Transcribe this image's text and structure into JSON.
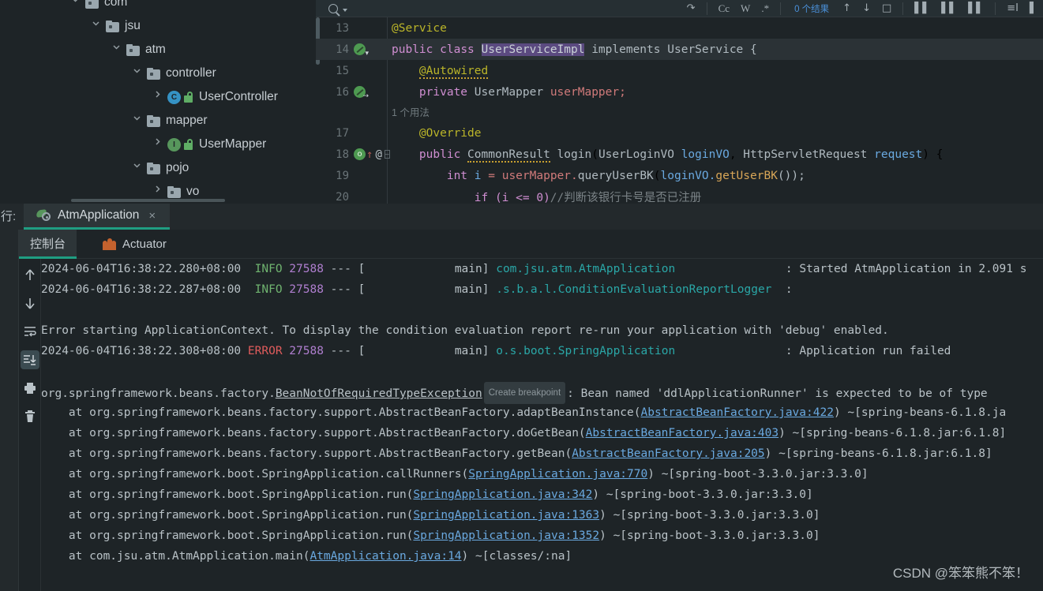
{
  "project_tree": {
    "items": [
      {
        "label": "com",
        "indent": 0,
        "icon": "folder-icon",
        "chevron": "down",
        "partial": true
      },
      {
        "label": "jsu",
        "indent": 1,
        "icon": "folder-icon",
        "chevron": "down"
      },
      {
        "label": "atm",
        "indent": 2,
        "icon": "folder-icon",
        "chevron": "down"
      },
      {
        "label": "controller",
        "indent": 3,
        "icon": "folder-icon",
        "chevron": "down"
      },
      {
        "label": "UserController",
        "indent": 4,
        "icon": "java-class-icon",
        "chevron": "right"
      },
      {
        "label": "mapper",
        "indent": 3,
        "icon": "folder-icon",
        "chevron": "down"
      },
      {
        "label": "UserMapper",
        "indent": 4,
        "icon": "java-interface-icon",
        "chevron": "right"
      },
      {
        "label": "pojo",
        "indent": 3,
        "icon": "folder-icon",
        "chevron": "down"
      },
      {
        "label": "vo",
        "indent": 4,
        "icon": "folder-icon",
        "chevron": "right"
      }
    ]
  },
  "find_bar": {
    "search_value": "",
    "search_placeholder": "",
    "result_count": "0 个结果",
    "buttons": [
      {
        "name": "regex-history-icon",
        "glyph": "↺"
      },
      {
        "name": "match-case-icon",
        "glyph": "Cc"
      },
      {
        "name": "words-icon",
        "glyph": "W"
      },
      {
        "name": "regex-icon",
        "glyph": ".*"
      },
      {
        "name": "prev-match-icon",
        "glyph": "↑"
      },
      {
        "name": "next-match-icon",
        "glyph": "↓"
      },
      {
        "name": "open-in-find-window-icon",
        "glyph": "◱"
      },
      {
        "name": "select-first-occurrence-icon",
        "glyph": "▐▐"
      },
      {
        "name": "select-all-occurrences-icon",
        "glyph": "▐▐"
      },
      {
        "name": "add-occurrence-icon",
        "glyph": "▐▐"
      },
      {
        "name": "filter-icon",
        "glyph": "≡I"
      },
      {
        "name": "more-options-icon",
        "glyph": "▐"
      }
    ]
  },
  "editor": {
    "lines": [
      {
        "num": "13",
        "markers": [],
        "indent": 0
      },
      {
        "num": "14",
        "markers": [
          "spring-bean-icon"
        ],
        "indent": 0,
        "highlight": true
      },
      {
        "num": "15",
        "markers": [],
        "indent": 1
      },
      {
        "num": "16",
        "markers": [
          "spring-bean-autowire-icon"
        ],
        "indent": 1
      },
      {
        "num": "",
        "markers": [],
        "indent": 1,
        "usage": "1 个用法"
      },
      {
        "num": "17",
        "markers": [],
        "indent": 1
      },
      {
        "num": "18",
        "markers": [
          "implementing-method-icon",
          "override-at-icon"
        ],
        "indent": 1,
        "fold": true
      },
      {
        "num": "19",
        "markers": [],
        "indent": 2
      },
      {
        "num": "20",
        "markers": [],
        "indent": 2
      }
    ],
    "code": {
      "l13_annotation": "@Service",
      "l14_public": "public",
      "l14_class": "class",
      "l14_name": "UserServiceImpl",
      "l14_implements": "implements",
      "l14_iface": "UserService",
      "l14_brace": "{",
      "l15_annotation": "@Autowired",
      "l16_private": "private",
      "l16_type": "UserMapper",
      "l16_field": "userMapper;",
      "l16_usage": "1 个用法",
      "l17_annotation": "@Override",
      "l18_public": "public",
      "l18_ret": "CommonResult",
      "l18_name": "login",
      "l18_p1type": "UserLoginVO",
      "l18_p1name": "loginVO",
      "l18_p2type": "HttpServletRequest",
      "l18_p2name": "request",
      "l19_kw": "int",
      "l19_var": "i",
      "l19_expr": "= userMapper.",
      "l19_call": "queryUserBK",
      "l19_arg": "loginVO.",
      "l19_getter": "getUserBK",
      "l19_tail": "());",
      "l20_text": "if (i <= 0)",
      "l20_comment": "//判断该银行卡号是否已注册"
    }
  },
  "run_panel": {
    "header_label": "行:",
    "tab": {
      "label": "AtmApplication",
      "icon": "spring-boot-run-icon",
      "close": "×"
    },
    "subtabs": [
      {
        "label": "控制台",
        "icon": null,
        "active": true
      },
      {
        "label": "Actuator",
        "icon": "actuator-icon",
        "active": false
      }
    ],
    "toolbar": [
      {
        "name": "scroll-up-button",
        "glyph": "↑",
        "active": false
      },
      {
        "name": "scroll-down-button",
        "glyph": "↓",
        "active": false
      },
      {
        "name": "soft-wrap-button",
        "glyph": "↩",
        "active": false
      },
      {
        "name": "scroll-to-end-button",
        "glyph": "⤓",
        "active": true
      },
      {
        "name": "print-button",
        "glyph": "⎙",
        "active": false
      },
      {
        "name": "clear-all-button",
        "glyph": "Ὕ1",
        "active": false
      }
    ]
  },
  "console_log": {
    "lines": [
      {
        "type": "info",
        "ts": "2024-06-04T16:38:22.280+08:00",
        "level": "INFO",
        "pid": "27588",
        "thread": "main",
        "logger": "com.jsu.atm.AtmApplication",
        "message": ": Started AtmApplication in 2.091 s"
      },
      {
        "type": "info",
        "ts": "2024-06-04T16:38:22.287+08:00",
        "level": "INFO",
        "pid": "27588",
        "thread": "main",
        "logger": ".s.b.a.l.ConditionEvaluationReportLogger",
        "message": ":"
      },
      {
        "type": "blank"
      },
      {
        "type": "plain",
        "text": "Error starting ApplicationContext. To display the condition evaluation report re-run your application with 'debug' enabled."
      },
      {
        "type": "error",
        "ts": "2024-06-04T16:38:22.308+08:00",
        "level": "ERROR",
        "pid": "27588",
        "thread": "main",
        "logger": "o.s.boot.SpringApplication",
        "message": ": Application run failed"
      },
      {
        "type": "blank"
      },
      {
        "type": "exception",
        "prefix": "org.springframework.beans.factory.",
        "exception": "BeanNotOfRequiredTypeException",
        "badge": "Create breakpoint",
        "message": ": Bean named 'ddlApplicationRunner' is expected to be of type"
      },
      {
        "type": "trace",
        "prefix": "    at org.springframework.beans.factory.support.AbstractBeanFactory.adaptBeanInstance(",
        "link": "AbstractBeanFactory.java:422",
        "suffix": ") ~[spring-beans-6.1.8.ja"
      },
      {
        "type": "trace",
        "prefix": "    at org.springframework.beans.factory.support.AbstractBeanFactory.doGetBean(",
        "link": "AbstractBeanFactory.java:403",
        "suffix": ") ~[spring-beans-6.1.8.jar:6.1.8]"
      },
      {
        "type": "trace",
        "prefix": "    at org.springframework.beans.factory.support.AbstractBeanFactory.getBean(",
        "link": "AbstractBeanFactory.java:205",
        "suffix": ") ~[spring-beans-6.1.8.jar:6.1.8]"
      },
      {
        "type": "trace",
        "prefix": "    at org.springframework.boot.SpringApplication.callRunners(",
        "link": "SpringApplication.java:770",
        "suffix": ") ~[spring-boot-3.3.0.jar:3.3.0]"
      },
      {
        "type": "trace",
        "prefix": "    at org.springframework.boot.SpringApplication.run(",
        "link": "SpringApplication.java:342",
        "suffix": ") ~[spring-boot-3.3.0.jar:3.3.0]"
      },
      {
        "type": "trace",
        "prefix": "    at org.springframework.boot.SpringApplication.run(",
        "link": "SpringApplication.java:1363",
        "suffix": ") ~[spring-boot-3.3.0.jar:3.3.0]"
      },
      {
        "type": "trace",
        "prefix": "    at org.springframework.boot.SpringApplication.run(",
        "link": "SpringApplication.java:1352",
        "suffix": ") ~[spring-boot-3.3.0.jar:3.3.0]"
      },
      {
        "type": "trace",
        "prefix": "    at com.jsu.atm.AtmApplication.main(",
        "link": "AtmApplication.java:14",
        "suffix": ") ~[classes/:na]"
      }
    ]
  },
  "watermark": "CSDN @笨笨熊不笨！",
  "colors": {
    "background": "#1e2427",
    "panel": "#23292c",
    "accent_green": "#1f9e82",
    "info": "#6fb36f",
    "error": "#e05c5c",
    "logger": "#2aa7a7",
    "link": "#6aa9e0",
    "selection": "#5b4a80"
  }
}
